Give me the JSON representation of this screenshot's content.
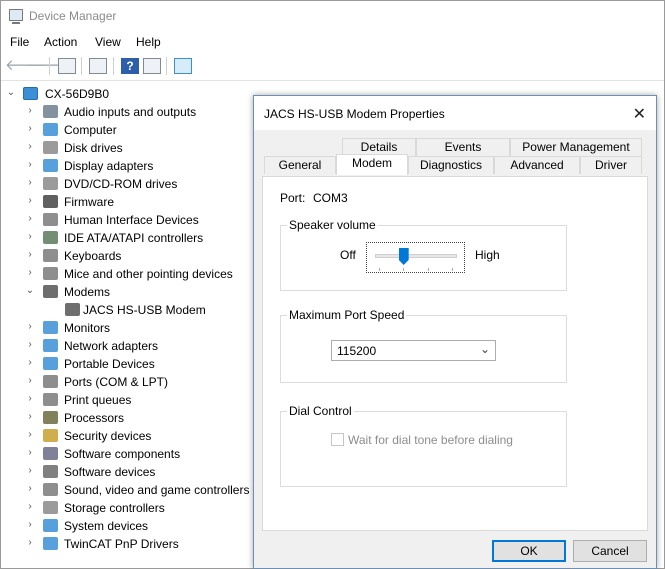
{
  "window": {
    "title": "Device Manager"
  },
  "menu": [
    "File",
    "Action",
    "View",
    "Help"
  ],
  "toolbar": {
    "help_glyph": "?",
    "back": "🡐",
    "forward": "🡒"
  },
  "tree": {
    "root": "CX-56D9B0",
    "items": [
      {
        "label": "Audio inputs and outputs",
        "icon": "speaker-icon",
        "color": "#6f7f8f"
      },
      {
        "label": "Computer",
        "icon": "computer-icon",
        "color": "#3b8fd6"
      },
      {
        "label": "Disk drives",
        "icon": "disk-icon",
        "color": "#8a8a8a"
      },
      {
        "label": "Display adapters",
        "icon": "display-adapter-icon",
        "color": "#3b8fd6"
      },
      {
        "label": "DVD/CD-ROM drives",
        "icon": "dvd-icon",
        "color": "#8a8a8a"
      },
      {
        "label": "Firmware",
        "icon": "firmware-icon",
        "color": "#444444"
      },
      {
        "label": "Human Interface Devices",
        "icon": "hid-icon",
        "color": "#7a7a7a"
      },
      {
        "label": "IDE ATA/ATAPI controllers",
        "icon": "ide-icon",
        "color": "#5a7a5a"
      },
      {
        "label": "Keyboards",
        "icon": "keyboard-icon",
        "color": "#7a7a7a"
      },
      {
        "label": "Mice and other pointing devices",
        "icon": "mouse-icon",
        "color": "#7a7a7a"
      },
      {
        "label": "Modems",
        "icon": "modem-icon",
        "color": "#555555",
        "expanded": true
      },
      {
        "label": "JACS HS-USB Modem",
        "icon": "modem-icon",
        "color": "#555555",
        "child": true
      },
      {
        "label": "Monitors",
        "icon": "monitor-icon",
        "color": "#3b8fd6"
      },
      {
        "label": "Network adapters",
        "icon": "network-icon",
        "color": "#3b8fd6"
      },
      {
        "label": "Portable Devices",
        "icon": "portable-icon",
        "color": "#3b8fd6"
      },
      {
        "label": "Ports (COM & LPT)",
        "icon": "port-icon",
        "color": "#7a7a7a"
      },
      {
        "label": "Print queues",
        "icon": "printer-icon",
        "color": "#7a7a7a"
      },
      {
        "label": "Processors",
        "icon": "processor-icon",
        "color": "#6b6b40"
      },
      {
        "label": "Security devices",
        "icon": "security-icon",
        "color": "#c8a030"
      },
      {
        "label": "Software components",
        "icon": "software-component-icon",
        "color": "#6a6a8a"
      },
      {
        "label": "Software devices",
        "icon": "software-device-icon",
        "color": "#6a6a6a"
      },
      {
        "label": "Sound, video and game controllers",
        "icon": "sound-icon",
        "color": "#7a7a7a"
      },
      {
        "label": "Storage controllers",
        "icon": "storage-icon",
        "color": "#8a8a8a"
      },
      {
        "label": "System devices",
        "icon": "system-icon",
        "color": "#3b8fd6"
      },
      {
        "label": "TwinCAT PnP Drivers",
        "icon": "driver-icon",
        "color": "#3b8fd6"
      }
    ]
  },
  "dialog": {
    "title": "JACS HS-USB Modem Properties",
    "close": "✕",
    "tabs_back": [
      "Details",
      "Events",
      "Power Management"
    ],
    "tabs_front": [
      "General",
      "Modem",
      "Diagnostics",
      "Advanced",
      "Driver"
    ],
    "active_tab": "Modem",
    "port_label": "Port:",
    "port_value": "COM3",
    "speaker": {
      "label": "Speaker volume",
      "off": "Off",
      "high": "High",
      "level": 0.35
    },
    "speed": {
      "label": "Maximum Port Speed",
      "value": "115200"
    },
    "dial": {
      "label": "Dial Control",
      "checkbox": "Wait for dial tone before dialing",
      "checked": false,
      "enabled": false
    },
    "ok": "OK",
    "cancel": "Cancel"
  }
}
